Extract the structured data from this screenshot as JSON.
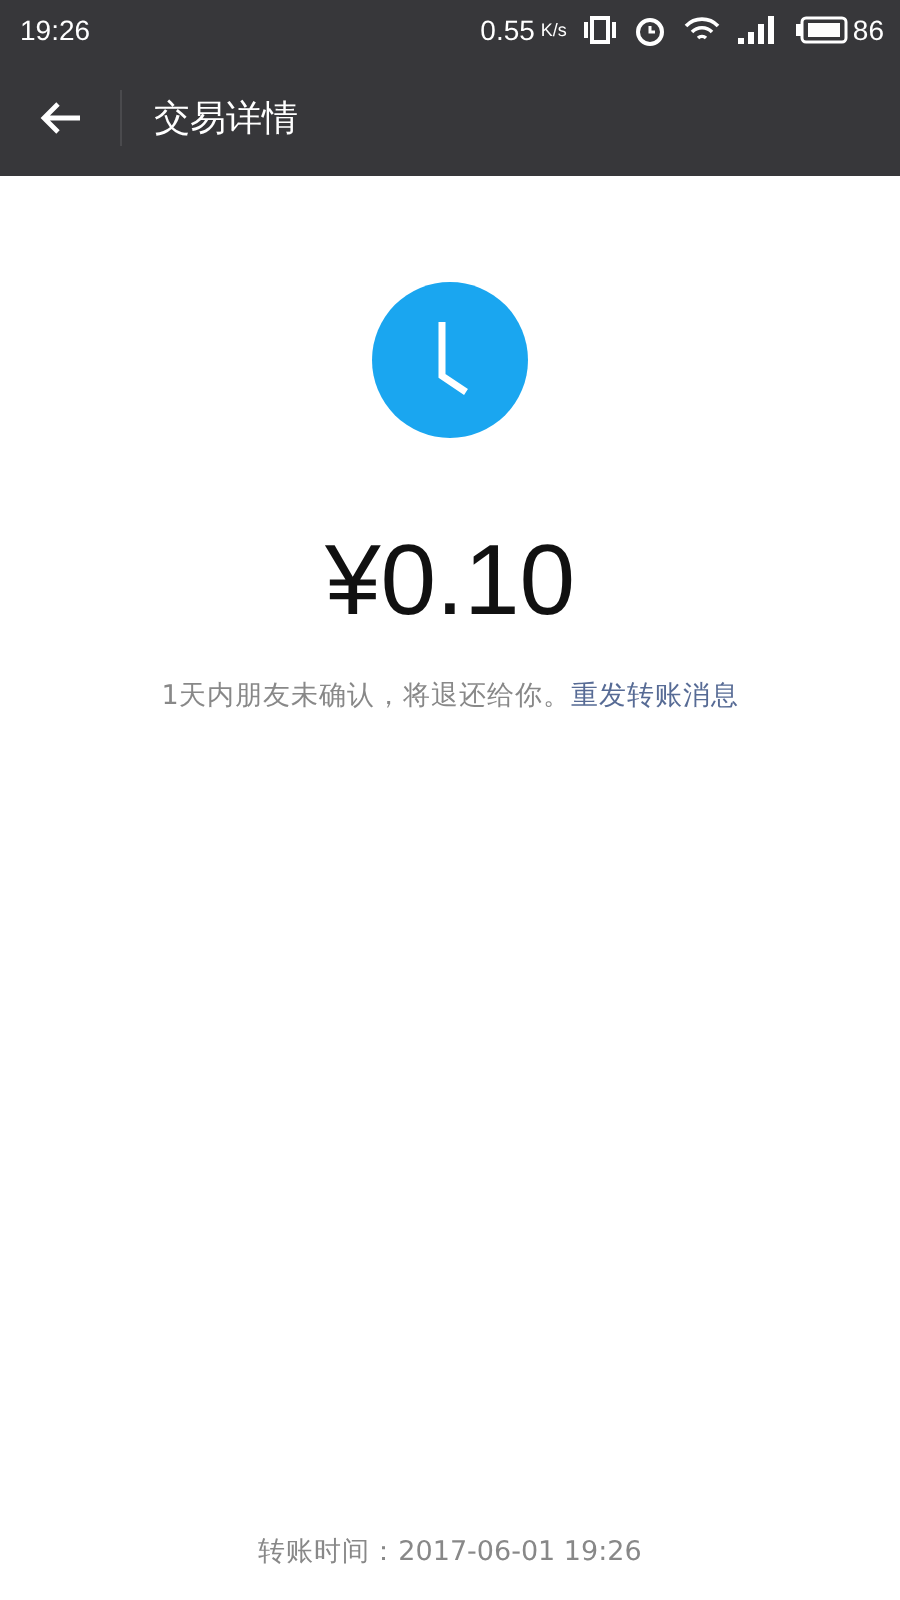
{
  "status_bar": {
    "time": "19:26",
    "speed": "0.55",
    "speed_unit": "K/s",
    "battery": "86"
  },
  "toolbar": {
    "title": "交易详情"
  },
  "amount": "¥0.10",
  "notice": {
    "text": "1天内朋友未确认，将退还给你。",
    "link": "重发转账消息"
  },
  "footer": "转账时间：2017-06-01 19:26"
}
